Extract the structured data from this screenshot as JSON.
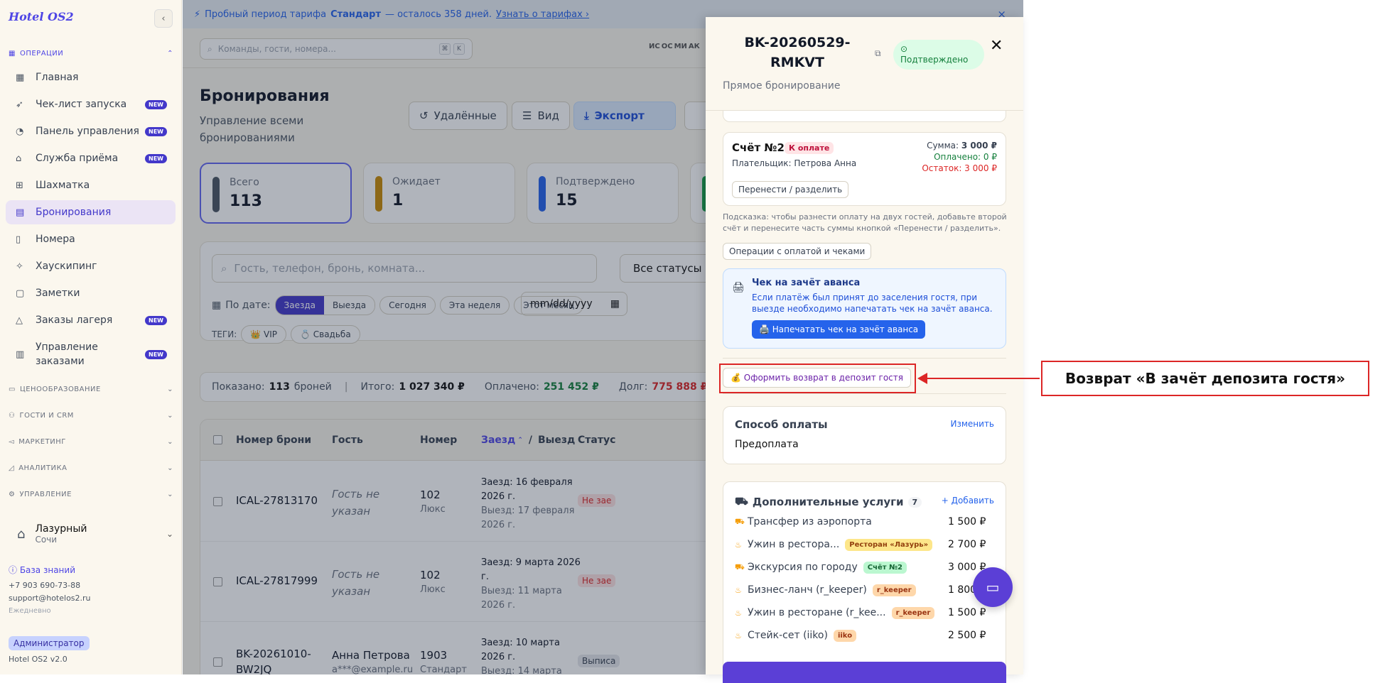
{
  "app": {
    "logo": "Hotel OS2"
  },
  "sidebar": {
    "section_ops": "ОПЕРАЦИИ",
    "items": [
      {
        "label": "Главная",
        "icon": "grid-icon",
        "new": false
      },
      {
        "label": "Чек-лист запуска",
        "icon": "rocket-icon",
        "new": true
      },
      {
        "label": "Панель управления",
        "icon": "gauge-icon",
        "new": true
      },
      {
        "label": "Служба приёма",
        "icon": "bell-icon",
        "new": true
      },
      {
        "label": "Шахматка",
        "icon": "table-icon",
        "new": false
      },
      {
        "label": "Бронирования",
        "icon": "clipboard-icon",
        "new": false
      },
      {
        "label": "Номера",
        "icon": "door-icon",
        "new": false
      },
      {
        "label": "Хаускипинг",
        "icon": "sparkle-icon",
        "new": false
      },
      {
        "label": "Заметки",
        "icon": "note-icon",
        "new": false
      },
      {
        "label": "Заказы лагеря",
        "icon": "tent-icon",
        "new": true
      },
      {
        "label": "Управление заказами",
        "icon": "receipt-icon",
        "new": true
      }
    ],
    "new_badge": "NEW",
    "sections": [
      "ЦЕНООБРАЗОВАНИЕ",
      "ГОСТИ И CRM",
      "МАРКЕТИНГ",
      "АНАЛИТИКА",
      "УПРАВЛЕНИЕ"
    ],
    "hotel": {
      "name": "Лазурный",
      "city": "Сочи"
    },
    "knowledge": "База знаний",
    "phone": "+7 903 690-73-88",
    "email": "support@hotelos2.ru",
    "schedule": "Ежедневно",
    "role": "Администратор",
    "version": "Hotel OS2 v2.0"
  },
  "banner": {
    "prefix": "Пробный период тарифа",
    "plan": "Стандарт",
    "rest": "— осталось 358 дней.",
    "link": "Узнать о тарифах ›",
    "close": "×"
  },
  "topbar": {
    "search_placeholder": "Команды, гости, номера...",
    "kbd1": "⌘",
    "kbd2": "K",
    "avatars": [
      "ИС",
      "ОС",
      "МИ",
      "АК"
    ]
  },
  "page": {
    "title": "Бронирования",
    "subtitle": "Управление всеми бронированиями",
    "buttons": {
      "deleted": "Удалённые",
      "view": "Вид",
      "export": "Экспорт"
    }
  },
  "stats": [
    {
      "label": "Всего",
      "value": "113",
      "color": "#4b5563"
    },
    {
      "label": "Ожидает",
      "value": "1",
      "color": "#ca8a04"
    },
    {
      "label": "Подтверждено",
      "value": "15",
      "color": "#2563eb"
    }
  ],
  "filters": {
    "search_placeholder": "Гость, телефон, бронь, комната...",
    "status": "Все статусы",
    "by_date": "По дате:",
    "checkin": "Заезда",
    "checkout": "Выезда",
    "today": "Сегодня",
    "week": "Эта неделя",
    "month": "Этот месяц",
    "date_placeholder": "mm/dd/yyyy",
    "tags_label": "ТЕГИ:",
    "tag_vip": "👑 VIP",
    "tag_wedding": "💍 Свадьба"
  },
  "summary": {
    "shown_label": "Показано:",
    "shown": "113",
    "shown_suffix": "броней",
    "total_label": "Итого:",
    "total": "1 027 340 ₽",
    "paid_label": "Оплачено:",
    "paid": "251 452 ₽",
    "debt_label": "Долг:",
    "debt": "775 888 ₽"
  },
  "table": {
    "headers": {
      "number": "Номер брони",
      "guest": "Гость",
      "room": "Номер",
      "checkin": "Заезд",
      "sep": "/",
      "checkout": "Выезд",
      "status": "Статус"
    },
    "rows": [
      {
        "id": "ICAL-27813170",
        "guest": "Гость не указан",
        "guest_sub": "",
        "room": "102",
        "room_type": "Люкс",
        "in": "Заезд: 16 февраля 2026 г.",
        "out": "Выезд: 17 февраля 2026 г.",
        "status": "Не зае"
      },
      {
        "id": "ICAL-27817999",
        "guest": "Гость не указан",
        "guest_sub": "",
        "room": "102",
        "room_type": "Люкс",
        "in": "Заезд: 9 марта 2026 г.",
        "out": "Выезд: 11 марта 2026 г.",
        "status": "Не зае"
      },
      {
        "id": "BK-20261010-BW2JQ",
        "guest": "Анна Петрова",
        "guest_sub": "a***@example.ru",
        "room": "1903",
        "room_type": "Стандарт",
        "in": "Заезд: 10 марта 2026 г.",
        "out": "Выезд: 14 марта",
        "status": "Выписа"
      }
    ]
  },
  "drawer": {
    "id": "BK-20260529-RMKVT",
    "status": "Подтверждено",
    "source": "Прямое бронирование",
    "invoice": {
      "title": "Счёт №2",
      "badge": "К оплате",
      "payer": "Плательщик: Петрова Анна",
      "sum_label": "Сумма:",
      "sum": "3 000 ₽",
      "paid": "Оплачено: 0 ₽",
      "rest": "Остаток: 3 000 ₽",
      "transfer_btn": "Перенести / разделить"
    },
    "hint": "Подсказка: чтобы разнести оплату на двух гостей, добавьте второй счёт и перенесите часть суммы кнопкой «Перенести / разделить».",
    "ops_btn": "Операции с оплатой и чеками",
    "advance": {
      "title": "Чек на зачёт аванса",
      "text": "Если платёж был принят до заселения гостя, при выезде необходимо напечатать чек на зачёт аванса.",
      "btn": "🖨️ Напечатать чек на зачёт аванса"
    },
    "refund_btn": "💰 Оформить возврат в депозит гостя",
    "payment": {
      "title": "Способ оплаты",
      "change": "Изменить",
      "value": "Предоплата"
    },
    "services": {
      "title": "Дополнительные услуги",
      "count": "7",
      "add": "+ Добавить",
      "items": [
        {
          "name": "Трансфер из аэропорта",
          "tag": "",
          "tag_bg": "",
          "tag_fg": "",
          "price": "1 500 ₽",
          "icon": "cart-icon"
        },
        {
          "name": "Ужин в рестора...",
          "tag": "Ресторан «Лазурь»",
          "tag_bg": "#fde68a",
          "tag_fg": "#92400e",
          "price": "2 700 ₽",
          "icon": "dish-icon"
        },
        {
          "name": "Экскурсия по городу",
          "tag": "Счёт №2",
          "tag_bg": "#bbf7d0",
          "tag_fg": "#166534",
          "price": "3 000 ₽",
          "icon": "cart-icon"
        },
        {
          "name": "Бизнес-ланч (r_keeper)",
          "tag": "r_keeper",
          "tag_bg": "#fed7aa",
          "tag_fg": "#9a3412",
          "price": "1 800",
          "icon": "dish-icon"
        },
        {
          "name": "Ужин в ресторане (r_kee...",
          "tag": "r_keeper",
          "tag_bg": "#fed7aa",
          "tag_fg": "#9a3412",
          "price": "1 500 ₽",
          "icon": "dish-icon"
        },
        {
          "name": "Стейк-сет (iiko)",
          "tag": "iiko",
          "tag_bg": "#fed7aa",
          "tag_fg": "#9a3412",
          "price": "2 500 ₽",
          "icon": "dish-icon"
        }
      ]
    }
  },
  "annotation": {
    "text": "Возврат «В зачёт депозита гостя»"
  }
}
